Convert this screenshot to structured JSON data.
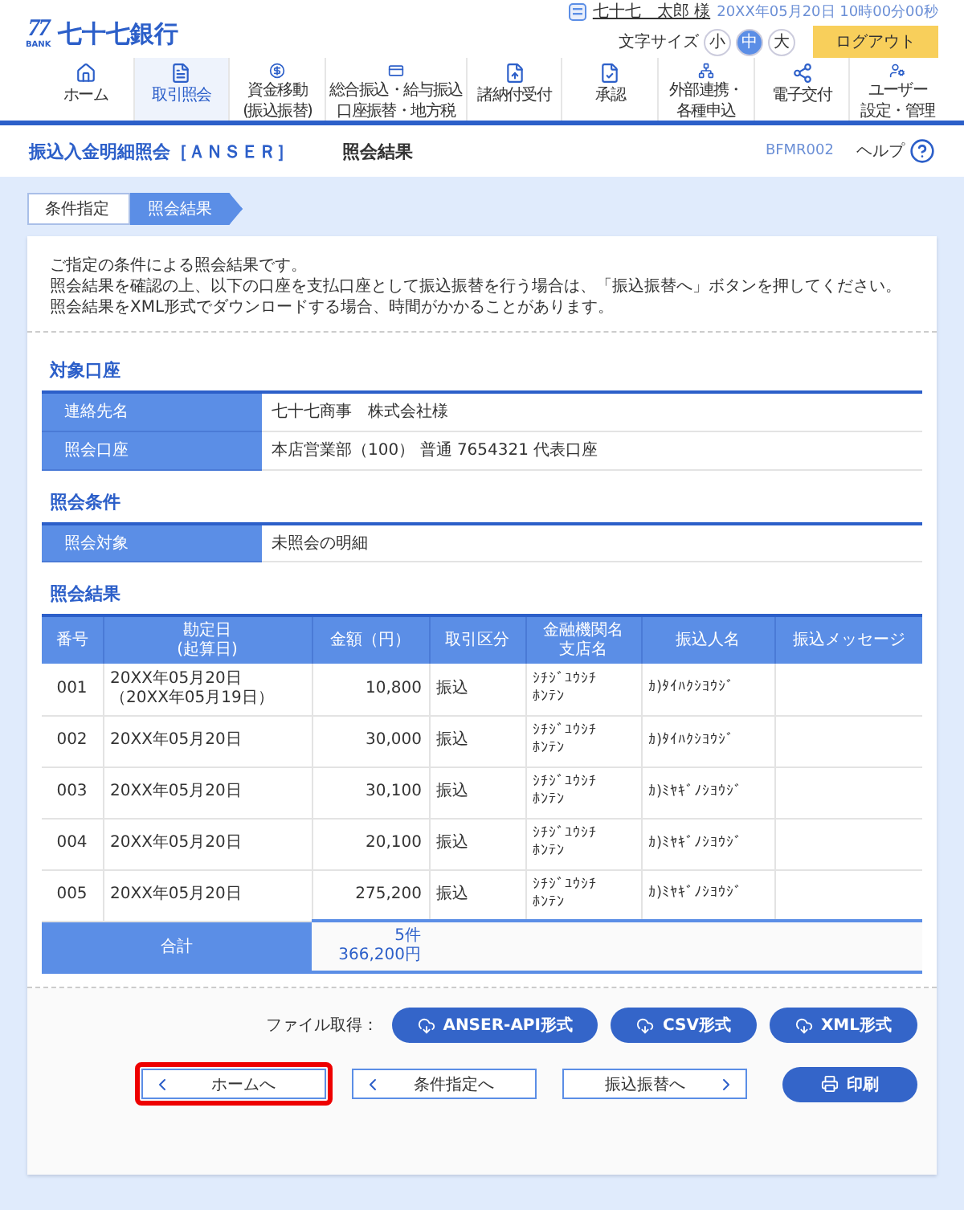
{
  "header": {
    "logo_mark": "77",
    "logo_sub": "BANK",
    "bank_name": "七十七銀行",
    "user_name": "七十七　太郎 様",
    "datetime": "20XX年05月20日 10時00分00秒",
    "font_size_label": "文字サイズ",
    "font_sizes": [
      {
        "label": "小",
        "selected": false
      },
      {
        "label": "中",
        "selected": true
      },
      {
        "label": "大",
        "selected": false
      }
    ],
    "logout": "ログアウト"
  },
  "nav": [
    {
      "kind": "home",
      "label": "ホーム",
      "selected": false
    },
    {
      "kind": "inquiry",
      "label": "取引照会",
      "selected": true
    },
    {
      "kind": "transfer",
      "label": [
        "資金移動",
        "(振込振替)"
      ],
      "selected": false
    },
    {
      "kind": "bulk",
      "label": [
        "総合振込・給与振込",
        "口座振替・地方税"
      ],
      "selected": false
    },
    {
      "kind": "tax",
      "label": "諸納付受付",
      "selected": false
    },
    {
      "kind": "approve",
      "label": "承認",
      "selected": false
    },
    {
      "kind": "link",
      "label": [
        "外部連携・",
        "各種申込"
      ],
      "selected": false
    },
    {
      "kind": "edelivery",
      "label": "電子交付",
      "selected": false
    },
    {
      "kind": "user",
      "label": [
        "ユーザー",
        "設定・管理"
      ],
      "selected": false
    }
  ],
  "page": {
    "title": "振込入金明細照会［ＡＮＳＥＲ］",
    "subtitle": "照会結果",
    "screen_id": "BFMR002",
    "help": "ヘルプ"
  },
  "steps": [
    {
      "label": "条件指定",
      "selected": false
    },
    {
      "label": "照会結果",
      "selected": true
    }
  ],
  "intro": [
    "ご指定の条件による照会結果です。",
    "照会結果を確認の上、以下の口座を支払口座として振込振替を行う場合は、「振込振替へ」ボタンを押してください。",
    "照会結果をXML形式でダウンロードする場合、時間がかかることがあります。"
  ],
  "account": {
    "title": "対象口座",
    "rows": [
      {
        "label": "連絡先名",
        "value": "七十七商事　株式会社様"
      },
      {
        "label": "照会口座",
        "value": "本店営業部（100） 普通 7654321 代表口座"
      }
    ]
  },
  "condition": {
    "title": "照会条件",
    "rows": [
      {
        "label": "照会対象",
        "value": "未照会の明細"
      }
    ]
  },
  "results": {
    "title": "照会結果",
    "columns": [
      [
        "番号"
      ],
      [
        "勘定日",
        "(起算日)"
      ],
      [
        "金額（円）"
      ],
      [
        "取引区分"
      ],
      [
        "金融機関名",
        "支店名"
      ],
      [
        "振込人名"
      ],
      [
        "振込メッセージ"
      ]
    ],
    "rows": [
      {
        "no": "001",
        "date": [
          "20XX年05月20日",
          "（20XX年05月19日）"
        ],
        "amount": "10,800",
        "type": "振込",
        "bank": [
          "ｼﾁｼﾞﾕｳｼﾁ",
          "ﾎﾝﾃﾝ"
        ],
        "payer": "ｶ)ﾀｲﾊｸｼﾖｳｼﾞ"
      },
      {
        "no": "002",
        "date": "20XX年05月20日",
        "amount": "30,000",
        "type": "振込",
        "bank": [
          "ｼﾁｼﾞﾕｳｼﾁ",
          "ﾎﾝﾃﾝ"
        ],
        "payer": "ｶ)ﾀｲﾊｸｼﾖｳｼﾞ"
      },
      {
        "no": "003",
        "date": "20XX年05月20日",
        "amount": "30,100",
        "type": "振込",
        "bank": [
          "ｼﾁｼﾞﾕｳｼﾁ",
          "ﾎﾝﾃﾝ"
        ],
        "payer": "ｶ)ﾐﾔｷﾞﾉｼﾖｳｼﾞ"
      },
      {
        "no": "004",
        "date": "20XX年05月20日",
        "amount": "20,100",
        "type": "振込",
        "bank": [
          "ｼﾁｼﾞﾕｳｼﾁ",
          "ﾎﾝﾃﾝ"
        ],
        "payer": "ｶ)ﾐﾔｷﾞﾉｼﾖｳｼﾞ"
      },
      {
        "no": "005",
        "date": "20XX年05月20日",
        "amount": "275,200",
        "type": "振込",
        "bank": [
          "ｼﾁｼﾞﾕｳｼﾁ",
          "ﾎﾝﾃﾝ"
        ],
        "payer": "ｶ)ﾐﾔｷﾞﾉｼﾖｳｼﾞ"
      }
    ],
    "total": {
      "label": "合計",
      "count": "5件",
      "amount": "366,200円"
    }
  },
  "file_label": "ファイル取得：",
  "file_buttons": [
    "ANSER-API形式",
    "CSV形式",
    "XML形式"
  ],
  "nav_buttons": [
    {
      "label": "ホームへ",
      "kind": "back",
      "highlighted": true
    },
    {
      "label": "条件指定へ",
      "kind": "back",
      "highlighted": false
    },
    {
      "label": "振込振替へ",
      "kind": "forward",
      "highlighted": false
    }
  ],
  "print_button": "印刷"
}
